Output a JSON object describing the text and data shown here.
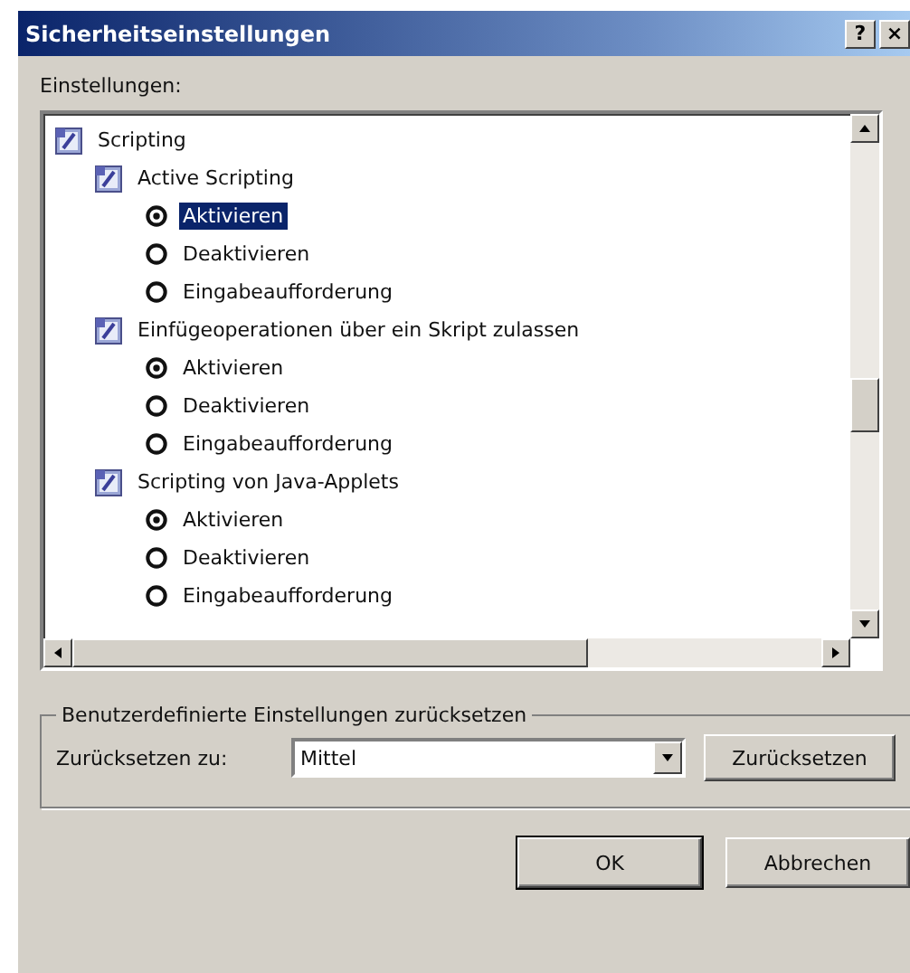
{
  "window": {
    "title": "Sicherheitseinstellungen",
    "title_buttons": [
      "?",
      "×"
    ]
  },
  "settings_label": "Einstellungen:",
  "tree": [
    {
      "label": "Scripting",
      "kind": "category",
      "children": [
        {
          "label": "Active Scripting",
          "kind": "setting",
          "children": [
            {
              "label": "Aktivieren",
              "kind": "option",
              "selected": true,
              "focused": true
            },
            {
              "label": "Deaktivieren",
              "kind": "option",
              "selected": false,
              "focused": false
            },
            {
              "label": "Eingabeaufforderung",
              "kind": "option",
              "selected": false,
              "focused": false
            }
          ]
        },
        {
          "label": "Einfügeoperationen über ein Skript zulassen",
          "kind": "setting",
          "children": [
            {
              "label": "Aktivieren",
              "kind": "option",
              "selected": true,
              "focused": false
            },
            {
              "label": "Deaktivieren",
              "kind": "option",
              "selected": false,
              "focused": false
            },
            {
              "label": "Eingabeaufforderung",
              "kind": "option",
              "selected": false,
              "focused": false
            }
          ]
        },
        {
          "label": "Scripting von Java-Applets",
          "kind": "setting",
          "children": [
            {
              "label": "Aktivieren",
              "kind": "option",
              "selected": true,
              "focused": false
            },
            {
              "label": "Deaktivieren",
              "kind": "option",
              "selected": false,
              "focused": false
            },
            {
              "label": "Eingabeaufforderung",
              "kind": "option",
              "selected": false,
              "focused": false
            }
          ]
        }
      ]
    }
  ],
  "reset_group": {
    "legend": "Benutzerdefinierte Einstellungen zurücksetzen",
    "label": "Zurücksetzen zu:",
    "value": "Mittel",
    "button": "Zurücksetzen"
  },
  "buttons": [
    "OK",
    "Abbrechen"
  ]
}
